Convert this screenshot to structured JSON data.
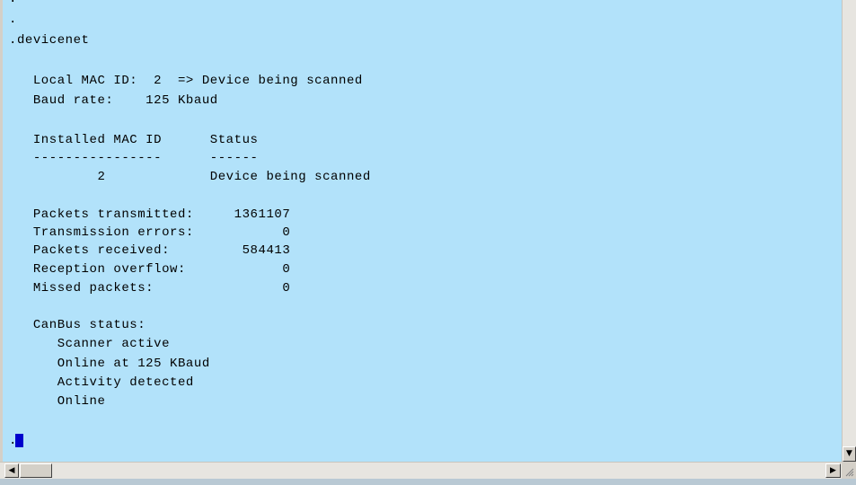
{
  "terminal": {
    "lines": [
      {
        "text": "."
      },
      {
        "text": "."
      },
      {
        "text": ".devicenet"
      },
      {
        "text": ""
      },
      {
        "text": "   Local MAC ID:  2  => Device being scanned"
      },
      {
        "text": "   Baud rate:    125 Kbaud"
      },
      {
        "text": ""
      },
      {
        "text": "   Installed MAC ID      Status"
      },
      {
        "text": "   ----------------      ------"
      },
      {
        "text": "           2             Device being scanned"
      },
      {
        "text": ""
      },
      {
        "text": "   Packets transmitted:     1361107"
      },
      {
        "text": "   Transmission errors:           0"
      },
      {
        "text": "   Packets received:         584413"
      },
      {
        "text": "   Reception overflow:            0"
      },
      {
        "text": "   Missed packets:                0"
      },
      {
        "text": ""
      },
      {
        "text": "   CanBus status:"
      },
      {
        "text": "      Scanner active"
      },
      {
        "text": "      Online at 125 KBaud"
      },
      {
        "text": "      Activity detected"
      },
      {
        "text": "      Online"
      },
      {
        "text": ""
      },
      {
        "text": "."
      }
    ],
    "background_color": "#b2e2fa",
    "cursor_color": "#0000cc"
  },
  "scrollbars": {
    "left_arrow_icon": "arrow-left-icon",
    "right_arrow_icon": "arrow-right-icon",
    "down_arrow_icon": "arrow-down-icon",
    "left_arrow_glyph": "◀",
    "right_arrow_glyph": "▶",
    "down_arrow_glyph": "▼"
  }
}
